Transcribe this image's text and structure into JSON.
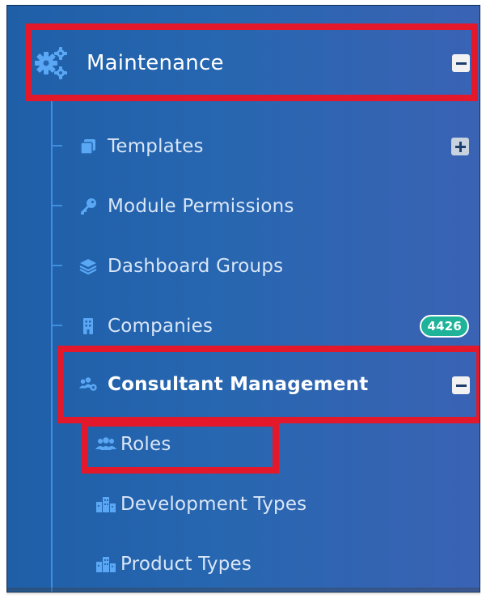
{
  "menu": {
    "section": {
      "label": "Maintenance",
      "icon": "cogs-icon",
      "toggle": "collapse"
    },
    "items": [
      {
        "label": "Templates",
        "icon": "copy-icon",
        "toggle": "expand"
      },
      {
        "label": "Module Permissions",
        "icon": "key-icon"
      },
      {
        "label": "Dashboard Groups",
        "icon": "layers-icon"
      },
      {
        "label": "Companies",
        "icon": "building-icon",
        "badge": "4426"
      },
      {
        "label": "Consultant Management",
        "icon": "users-cog-icon",
        "toggle": "collapse"
      }
    ],
    "subitems": [
      {
        "label": "Roles",
        "icon": "users-icon"
      },
      {
        "label": "Development Types",
        "icon": "city-icon"
      },
      {
        "label": "Product Types",
        "icon": "city-icon"
      }
    ]
  },
  "colors": {
    "panel_bg": "#2766b0",
    "highlight": "#e3182a",
    "badge": "#1fb39a",
    "icon_blue": "#5aa8f5"
  }
}
